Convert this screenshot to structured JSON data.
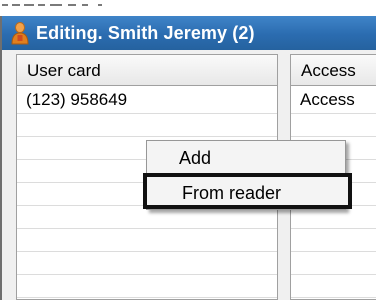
{
  "window": {
    "title": "Editing. Smith Jeremy (2)",
    "title_bar_color": "#2b6cb0"
  },
  "left_panel": {
    "header": "User card",
    "rows": [
      "(123) 958649",
      "",
      "",
      "",
      "",
      "",
      "",
      "",
      ""
    ]
  },
  "right_panel": {
    "header": "Access",
    "rows": [
      "Access",
      "",
      "",
      "",
      "",
      "",
      "",
      "",
      ""
    ]
  },
  "context_menu": {
    "items": [
      {
        "label": "Add",
        "highlighted": false
      },
      {
        "label": "From reader",
        "highlighted": true
      }
    ]
  },
  "icons": {
    "title": "user-icon"
  }
}
